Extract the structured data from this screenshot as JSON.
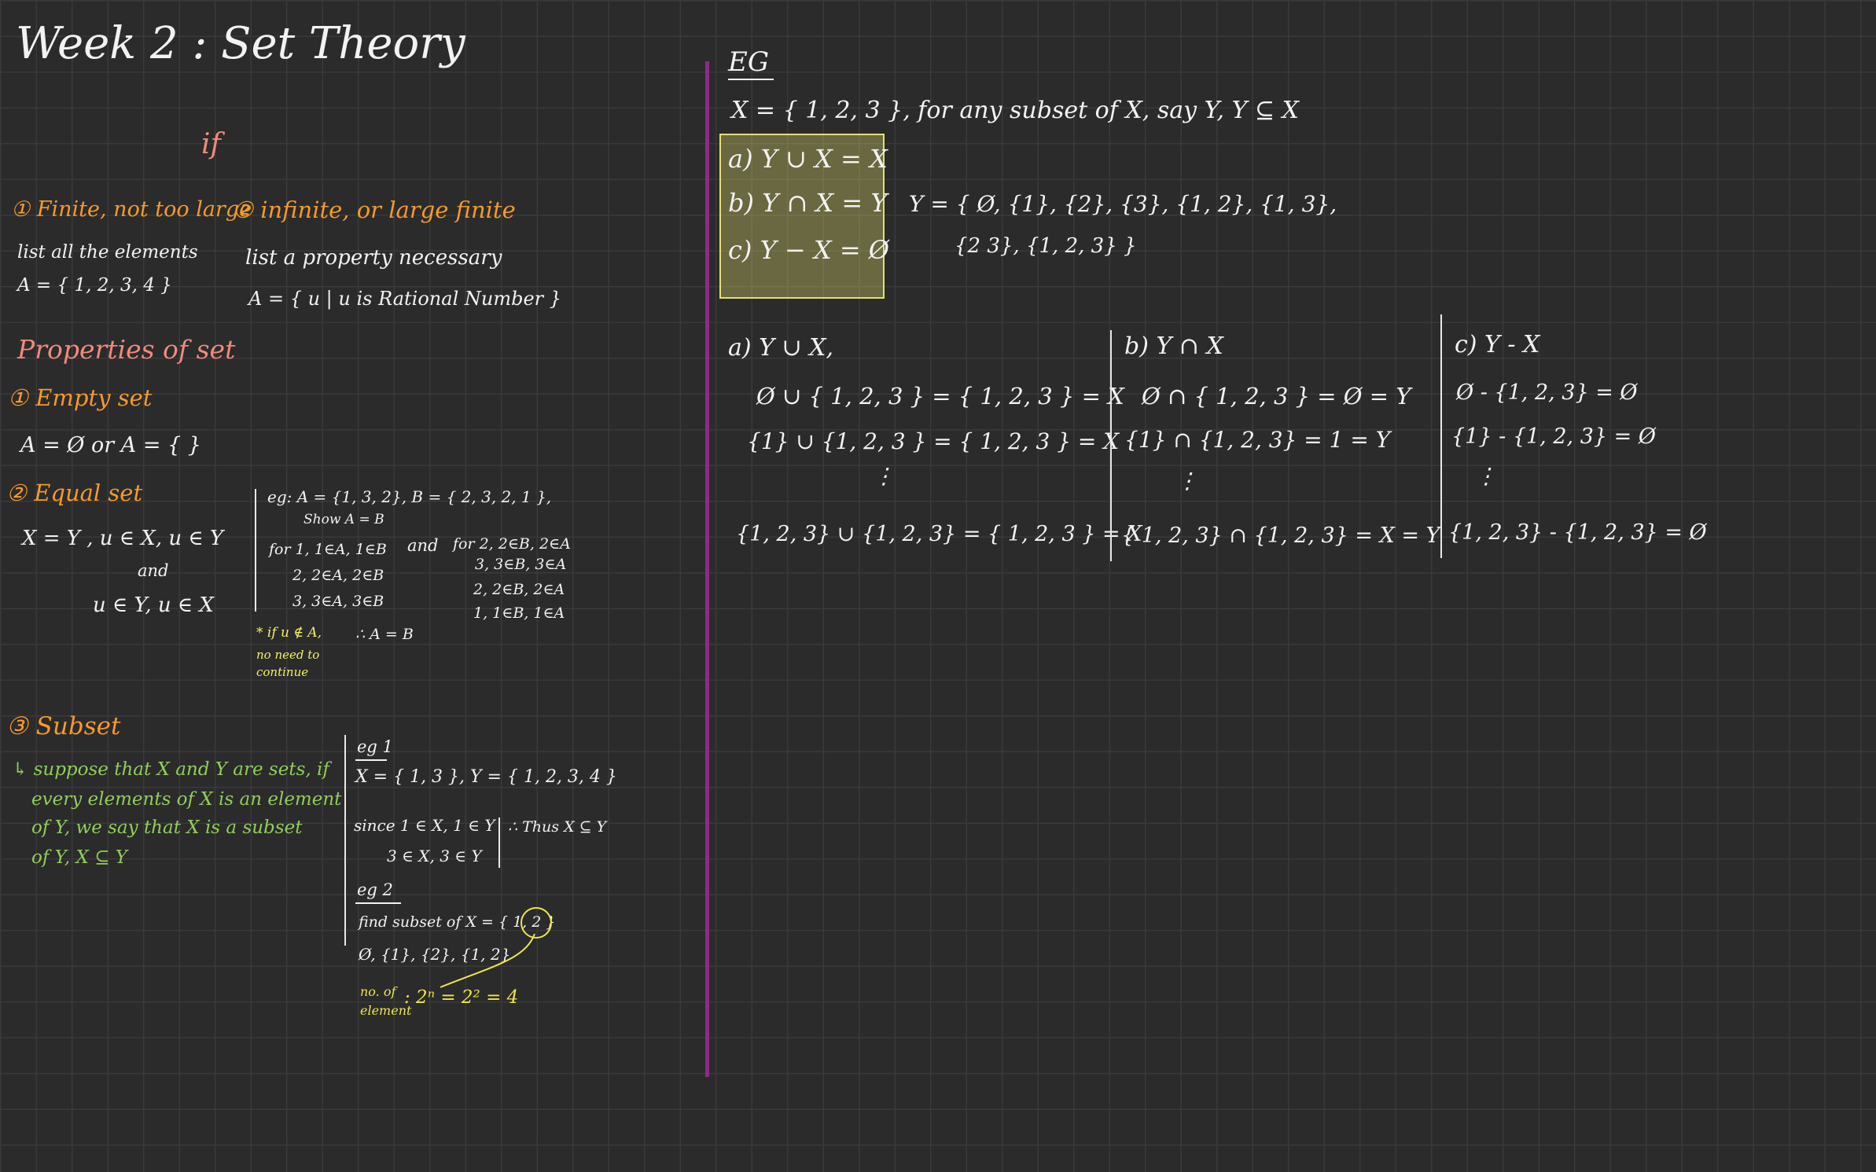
{
  "title": "Week 2 : Set Theory",
  "left": {
    "if_label": "if",
    "finite": {
      "heading": "① Finite, not too large",
      "line1": "list all the elements",
      "line2": "A = { 1, 2, 3, 4 }"
    },
    "infinite": {
      "heading": "② infinite, or large finite",
      "line1": "list a property necessary",
      "line2": "A = { u | u is Rational Number }"
    },
    "properties_heading": "Properties of set",
    "empty_set": {
      "heading": "① Empty set",
      "line": "A = Ø or A = { }"
    },
    "equal_set": {
      "heading": "② Equal set",
      "l1": "X = Y ,   u ∈ X, u ∈ Y",
      "l2": "and",
      "l3": "u ∈ Y,  u ∈ X",
      "eg1": "eg:  A = {1, 3, 2},  B = { 2, 3, 2, 1 },",
      "eg2": "Show  A = B",
      "for1a": "for 1,  1∈A,  1∈B",
      "for1b": "2,  2∈A,  2∈B",
      "for1c": "3,  3∈A,  3∈B",
      "and": "and",
      "for2a": "for 2,  2∈B,  2∈A",
      "for2b": "3,  3∈B,  3∈A",
      "for2c": "2,  2∈B,  2∈A",
      "for2d": "1,  1∈B,  1∈A",
      "therefore": "∴ A = B",
      "note1": "* if u ∉ A,",
      "note2": "no need to",
      "note3": "continue"
    },
    "subset": {
      "heading": "③ Subset",
      "d1": "↳ suppose that  X and Y are sets, if",
      "d2": "every elements of X is an element",
      "d3": "of Y, we say  that X is a subset",
      "d4": "of Y,    X ⊆ Y",
      "eg1_label": "eg 1",
      "eg1_line": "X = { 1, 3 },  Y = { 1, 2, 3, 4 }",
      "since1": "since  1 ∈ X,   1 ∈ Y",
      "since2": "3 ∈ X,   3 ∈ Y",
      "thus": "∴ Thus  X ⊆ Y",
      "eg2_label": "eg 2",
      "find": "find  subset  of   X = { 1, 2 }",
      "subsets": "Ø, {1}, {2}, {1, 2}",
      "no_of1": "no. of",
      "no_of2": "element",
      "formula": ": 2ⁿ = 2² = 4"
    }
  },
  "right": {
    "eg_label": "EG",
    "premise": "X = { 1, 2, 3 },  for any  subset of X,  say Y,    Y ⊆ X",
    "box": {
      "a": "a) Y ∪ X = X",
      "b": "b) Y ∩ X = Y",
      "c": "c) Y − X = Ø"
    },
    "y_list1": "Y = { Ø, {1},  {2},  {3}, {1, 2}, {1, 3},",
    "y_list2": "{2  3}, {1, 2, 3} }",
    "col_a": {
      "heading": "a) Y ∪ X,",
      "r1": "Ø  ∪  { 1, 2, 3 }  =  { 1, 2, 3 } = X",
      "r2": "{1}  ∪  {1, 2, 3 }  =  { 1, 2, 3 } = X",
      "dots": "⋮",
      "r3": "{1, 2, 3} ∪ {1, 2, 3}  =  { 1, 2, 3 }  =  X"
    },
    "col_b": {
      "heading": "b) Y ∩ X",
      "r1": "Ø ∩ { 1, 2, 3 } = Ø = Y",
      "r2": "{1} ∩ {1, 2, 3} =  1  =  Y",
      "dots": "⋮",
      "r3": "{ 1, 2, 3} ∩ {1, 2, 3} = X = Y"
    },
    "col_c": {
      "heading": "c) Y - X",
      "r1": "Ø - {1, 2, 3} = Ø",
      "r2": "{1} - {1, 2, 3} = Ø",
      "dots": "⋮",
      "r3": "{1, 2, 3} - {1, 2, 3} = Ø"
    }
  }
}
